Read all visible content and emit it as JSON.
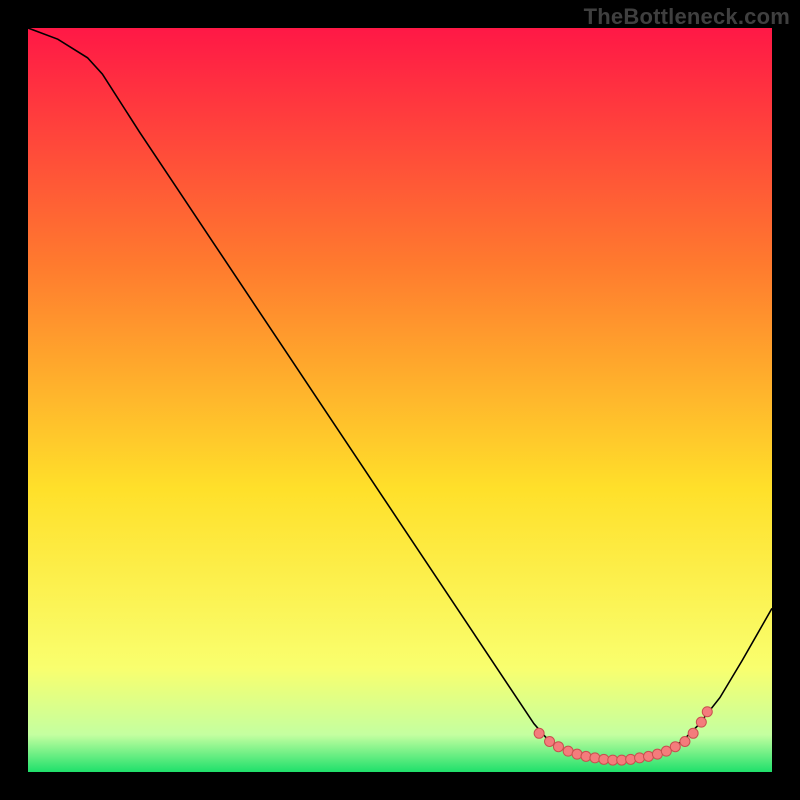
{
  "watermark": "TheBottleneck.com",
  "chart_data": {
    "type": "line",
    "title": "",
    "xlabel": "",
    "ylabel": "",
    "xlim": [
      0,
      100
    ],
    "ylim": [
      0,
      100
    ],
    "grid": false,
    "series": [
      {
        "name": "curve",
        "points": [
          [
            0,
            100
          ],
          [
            4,
            98.5
          ],
          [
            8,
            96
          ],
          [
            10,
            93.8
          ],
          [
            15,
            86
          ],
          [
            20,
            78.5
          ],
          [
            25,
            71
          ],
          [
            30,
            63.5
          ],
          [
            35,
            56
          ],
          [
            40,
            48.5
          ],
          [
            45,
            41
          ],
          [
            50,
            33.5
          ],
          [
            55,
            26
          ],
          [
            60,
            18.5
          ],
          [
            65,
            11
          ],
          [
            68,
            6.5
          ],
          [
            70,
            4.2
          ],
          [
            72,
            3.0
          ],
          [
            74,
            2.25
          ],
          [
            76,
            1.8
          ],
          [
            78,
            1.6
          ],
          [
            80,
            1.6
          ],
          [
            82,
            1.8
          ],
          [
            84,
            2.2
          ],
          [
            86,
            3.0
          ],
          [
            88,
            4.2
          ],
          [
            90,
            6.2
          ],
          [
            93,
            10
          ],
          [
            96,
            15
          ],
          [
            100,
            22
          ]
        ]
      }
    ],
    "marker_points": [
      [
        68.7,
        5.2
      ],
      [
        70.1,
        4.1
      ],
      [
        71.3,
        3.4
      ],
      [
        72.6,
        2.8
      ],
      [
        73.8,
        2.4
      ],
      [
        75.0,
        2.1
      ],
      [
        76.2,
        1.9
      ],
      [
        77.4,
        1.7
      ],
      [
        78.6,
        1.6
      ],
      [
        79.8,
        1.6
      ],
      [
        81.0,
        1.7
      ],
      [
        82.2,
        1.9
      ],
      [
        83.4,
        2.1
      ],
      [
        84.6,
        2.4
      ],
      [
        85.8,
        2.8
      ],
      [
        87.0,
        3.4
      ],
      [
        88.3,
        4.1
      ],
      [
        89.4,
        5.2
      ],
      [
        90.5,
        6.7
      ],
      [
        91.3,
        8.1
      ]
    ],
    "gradient": {
      "top": "#ff1846",
      "mid_top": "#ff7b2e",
      "mid": "#ffe02a",
      "mid_bottom": "#f9ff6e",
      "bottom_pale": "#c4ffa0",
      "bottom_green": "#1fe06b"
    },
    "marker_style": {
      "fill": "#f47c7c",
      "stroke": "#c94f4f",
      "radius": 5
    },
    "line_style": {
      "stroke": "#000000",
      "width": 1.6
    }
  }
}
